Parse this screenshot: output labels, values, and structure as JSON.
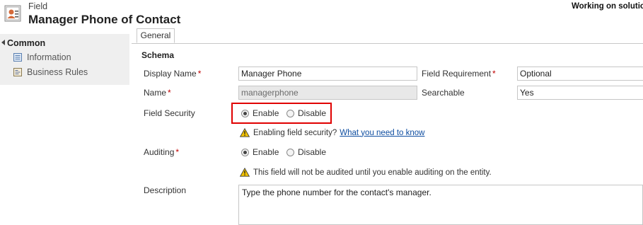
{
  "header": {
    "entity_type": "Field",
    "title": "Manager Phone of Contact",
    "solution_status": "Working on solution"
  },
  "nav": {
    "group_label": "Common",
    "items": [
      {
        "label": "Information",
        "icon": "information-icon"
      },
      {
        "label": "Business Rules",
        "icon": "business-rules-icon"
      }
    ]
  },
  "tabs": [
    {
      "label": "General"
    }
  ],
  "schema": {
    "section_title": "Schema",
    "display_name": {
      "label": "Display Name",
      "value": "Manager Phone"
    },
    "name": {
      "label": "Name",
      "value": "managerphone"
    },
    "field_requirement": {
      "label": "Field Requirement",
      "value": "Optional"
    },
    "searchable": {
      "label": "Searchable",
      "value": "Yes"
    },
    "field_security": {
      "label": "Field Security",
      "enable_label": "Enable",
      "disable_label": "Disable",
      "selected": "Enable",
      "notice_text": "Enabling field security?",
      "notice_link": "What you need to know"
    },
    "auditing": {
      "label": "Auditing",
      "enable_label": "Enable",
      "disable_label": "Disable",
      "selected": "Enable",
      "notice_text": "This field will not be audited until you enable auditing on the entity."
    },
    "description": {
      "label": "Description",
      "value": "Type the phone number for the contact's manager."
    }
  },
  "colors": {
    "highlight": "#e00000",
    "required_marker": "#c00000",
    "link": "#0f4ea1",
    "warning": "#f2c200"
  }
}
